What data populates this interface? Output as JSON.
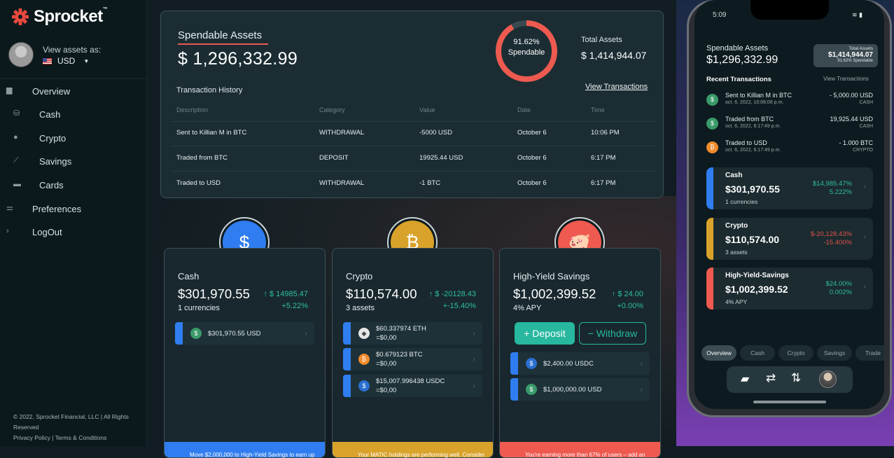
{
  "sidebar": {
    "logo": "Sprocket",
    "logo_tm": "™",
    "view_assets_label": "View assets as:",
    "currency": "USD",
    "nav": [
      {
        "label": "Overview",
        "icon": "wallet-icon"
      },
      {
        "label": "Cash",
        "icon": "coins-icon"
      },
      {
        "label": "Crypto",
        "icon": "crypto-coins-icon"
      },
      {
        "label": "Savings",
        "icon": "chart-line-icon"
      },
      {
        "label": "Cards",
        "icon": "card-icon"
      },
      {
        "label": "Preferences",
        "icon": "sliders-icon"
      },
      {
        "label": "LogOut",
        "icon": "chevron-right-icon"
      }
    ],
    "footer_line1": "© 2022, Sprocket Financial, LLC | All Rights Reserved",
    "footer_line2": "Privacy Policy | Terms & Conditions"
  },
  "summary": {
    "title": "Spendable Assets",
    "amount": "$ 1,296,332.99",
    "spendable_pct": "91.62%",
    "spendable_label": "Spendable",
    "spendable_fraction": 0.9162,
    "total_label": "Total Assets",
    "total_value": "$ 1,414,944.07",
    "history_title": "Transaction History",
    "view_link": "View Transactions",
    "columns": [
      "Description",
      "Category",
      "Value",
      "Date",
      "Time"
    ],
    "rows": [
      [
        "Sent to Killian M in BTC",
        "WITHDRAWAL",
        "-5000 USD",
        "October 6",
        "10:06 PM"
      ],
      [
        "Traded from BTC",
        "DEPOSIT",
        "19925.44 USD",
        "October 6",
        "6:17 PM"
      ],
      [
        "Traded to USD",
        "WITHDRAWAL",
        "-1 BTC",
        "October 6",
        "6:17 PM"
      ]
    ]
  },
  "cards": {
    "cash": {
      "title": "Cash",
      "amount": "$301,970.55",
      "sub": "1 currencies",
      "change": "↑ $ 14985.47",
      "pct": "+5.22%",
      "items": [
        {
          "text": "$301,970.55 USD",
          "icon": "dollar-icon"
        }
      ],
      "banner": "Move $2,000,000 to High-Yield Savings to earn up"
    },
    "crypto": {
      "title": "Crypto",
      "amount": "$110,574.00",
      "sub": "3 assets",
      "change": "↑ $ -20128.43",
      "pct": "+-15.40%",
      "items": [
        {
          "line1": "$60.337974 ETH",
          "line2": "=$0,00",
          "icon": "ethereum-icon"
        },
        {
          "line1": "$0.679123 BTC",
          "line2": "=$0,00",
          "icon": "bitcoin-icon"
        },
        {
          "line1": "$15,007.996438 USDC",
          "line2": "=$0,00",
          "icon": "usdc-icon"
        }
      ],
      "banner": "Your MATIC holdings are performing well. Consider"
    },
    "savings": {
      "title": "High-Yield Savings",
      "amount": "$1,002,399.52",
      "sub": "4% APY",
      "change": "↑ $ 24.00",
      "pct": "+0.00%",
      "deposit": "+ Deposit",
      "withdraw": "− Withdraw",
      "items": [
        {
          "text": "$2,400.00 USDC",
          "icon": "usdc-icon"
        },
        {
          "text": "$1,000,000.00 USD",
          "icon": "dollar-icon"
        }
      ],
      "banner": "You're earning more than 67% of users – add an"
    }
  },
  "phone": {
    "time": "5:09",
    "spendable_label": "Spendable Assets",
    "spendable_value": "$1,296,332.99",
    "total_label": "Total Assets",
    "total_value": "$1,414,944.07",
    "total_sub": "91.62% Spendable",
    "recent_title": "Recent Transactions",
    "view_link": "View Transactions",
    "transactions": [
      {
        "title": "Sent to Killian M in BTC",
        "date": "oct. 6, 2022, 10:06:06 p.m.",
        "amount": "- 5,000.00 USD",
        "cat": "CASH",
        "icon": "dollar-icon"
      },
      {
        "title": "Traded from BTC",
        "date": "oct. 6, 2022, 6:17:49 p.m.",
        "amount": "19,925.44 USD",
        "cat": "CASH",
        "icon": "dollar-icon"
      },
      {
        "title": "Traded to USD",
        "date": "oct. 6, 2022, 6:17:49 p.m.",
        "amount": "- 1.000 BTC",
        "cat": "CRYPTO",
        "icon": "bitcoin-icon"
      }
    ],
    "cards": [
      {
        "title": "Cash",
        "amount": "$301,970.55",
        "sub": "1 currencies",
        "chg": "$14,985.47%",
        "pct": "5.222%",
        "color": "#2f7df0",
        "chg_color": "#2fbf9f"
      },
      {
        "title": "Crypto",
        "amount": "$110,574.00",
        "sub": "3 assets",
        "chg": "$-20,128.43%",
        "pct": "-15.400%",
        "color": "#d9a22a",
        "chg_color": "#e0524a"
      },
      {
        "title": "High-Yield-Savings",
        "amount": "$1,002,399.52",
        "sub": "4% APY",
        "chg": "$24.00%",
        "pct": "0.002%",
        "color": "#ee5a4f",
        "chg_color": "#2fbf9f"
      }
    ],
    "tabs": [
      "Overview",
      "Cash",
      "Crypto",
      "Savings",
      "Trade"
    ]
  },
  "colors": {
    "accent_red": "#e85a4f",
    "cash_blue": "#2f7df0",
    "crypto_gold": "#d9a22a",
    "savings_red": "#ee5a4f",
    "positive": "#2fbf9f"
  }
}
